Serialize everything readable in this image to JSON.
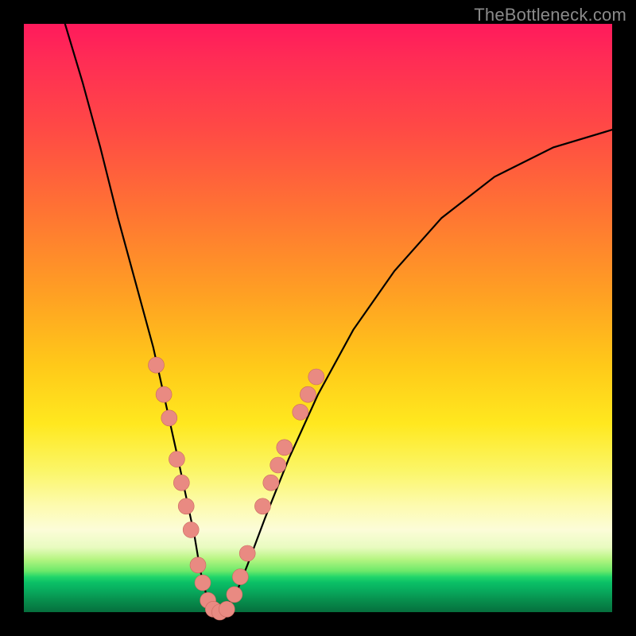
{
  "watermark": "TheBottleneck.com",
  "colors": {
    "dot_fill": "#e98a82",
    "dot_stroke": "#c96a60",
    "curve_stroke": "#000000",
    "frame_bg": "#000000"
  },
  "chart_data": {
    "type": "line",
    "title": "",
    "xlabel": "",
    "ylabel": "",
    "xlim": [
      0,
      100
    ],
    "ylim": [
      0,
      100
    ],
    "grid": false,
    "legend": null,
    "series": [
      {
        "name": "bottleneck-curve",
        "x": [
          7,
          10,
          13,
          16,
          19,
          22,
          24,
          26,
          27.5,
          29,
          30,
          31,
          32,
          33,
          34,
          36,
          38,
          41,
          45,
          50,
          56,
          63,
          71,
          80,
          90,
          100
        ],
        "y": [
          100,
          90,
          79,
          67,
          56,
          45,
          36,
          27,
          20,
          13,
          7,
          3,
          1,
          0,
          0.5,
          3,
          8,
          16,
          26,
          37,
          48,
          58,
          67,
          74,
          79,
          82
        ]
      }
    ],
    "markers": [
      {
        "series": "left-branch",
        "x": 22.5,
        "y": 42
      },
      {
        "series": "left-branch",
        "x": 23.8,
        "y": 37
      },
      {
        "series": "left-branch",
        "x": 24.7,
        "y": 33
      },
      {
        "series": "left-branch",
        "x": 26.0,
        "y": 26
      },
      {
        "series": "left-branch",
        "x": 26.8,
        "y": 22
      },
      {
        "series": "left-branch",
        "x": 27.6,
        "y": 18
      },
      {
        "series": "left-branch",
        "x": 28.4,
        "y": 14
      },
      {
        "series": "left-branch",
        "x": 29.6,
        "y": 8
      },
      {
        "series": "left-branch",
        "x": 30.4,
        "y": 5
      },
      {
        "series": "left-branch",
        "x": 31.3,
        "y": 2
      },
      {
        "series": "bottom",
        "x": 32.2,
        "y": 0.5
      },
      {
        "series": "bottom",
        "x": 33.3,
        "y": 0
      },
      {
        "series": "bottom",
        "x": 34.5,
        "y": 0.5
      },
      {
        "series": "right-branch",
        "x": 35.8,
        "y": 3
      },
      {
        "series": "right-branch",
        "x": 36.8,
        "y": 6
      },
      {
        "series": "right-branch",
        "x": 38.0,
        "y": 10
      },
      {
        "series": "right-branch",
        "x": 40.6,
        "y": 18
      },
      {
        "series": "right-branch",
        "x": 42.0,
        "y": 22
      },
      {
        "series": "right-branch",
        "x": 43.2,
        "y": 25
      },
      {
        "series": "right-branch",
        "x": 44.3,
        "y": 28
      },
      {
        "series": "right-branch",
        "x": 47.0,
        "y": 34
      },
      {
        "series": "right-branch",
        "x": 48.3,
        "y": 37
      },
      {
        "series": "right-branch",
        "x": 49.7,
        "y": 40
      }
    ],
    "marker_radius": 10
  }
}
